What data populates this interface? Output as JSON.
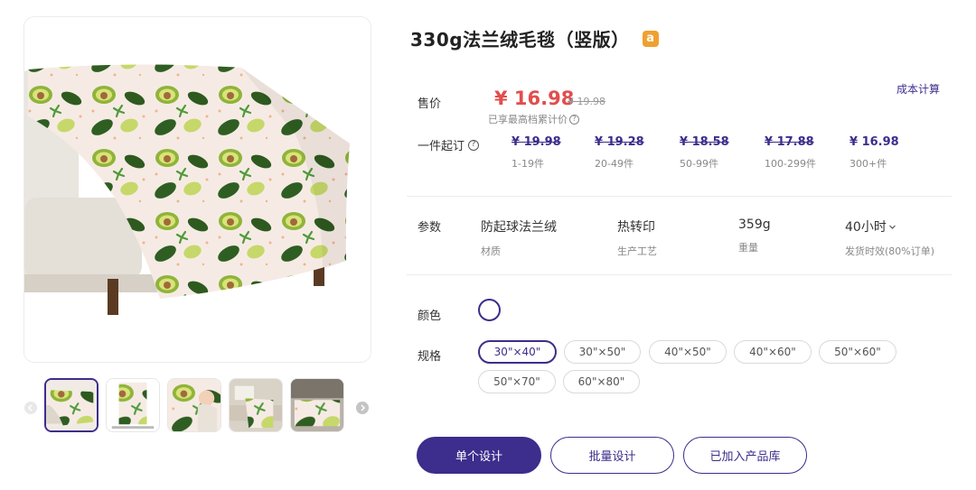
{
  "product": {
    "title": "330g法兰绒毛毯（竖版）",
    "store_badge": "a"
  },
  "pricing": {
    "price_label": "售价",
    "price": "¥ 16.98",
    "original_price": "¥ 19.98",
    "note": "已享最高档累计价",
    "cost_link": "成本计算",
    "moq_label": "一件起订",
    "tiers": [
      {
        "price": "¥ 19.98",
        "range": "1-19件",
        "strike": true
      },
      {
        "price": "¥ 19.28",
        "range": "20-49件",
        "strike": true
      },
      {
        "price": "¥ 18.58",
        "range": "50-99件",
        "strike": true
      },
      {
        "price": "¥ 17.88",
        "range": "100-299件",
        "strike": true
      },
      {
        "price": "¥ 16.98",
        "range": "300+件",
        "strike": false
      }
    ]
  },
  "params": {
    "label": "参数",
    "items": [
      {
        "value": "防起球法兰绒",
        "key": "材质"
      },
      {
        "value": "热转印",
        "key": "生产工艺"
      },
      {
        "value": "359g",
        "key": "重量"
      },
      {
        "value": "40小时",
        "key": "发货时效(80%订单)"
      }
    ]
  },
  "options": {
    "color_label": "颜色",
    "size_label": "规格",
    "selected_color": "#ffffff",
    "sizes": [
      "30\"×40\"",
      "30\"×50\"",
      "40\"×50\"",
      "40\"×60\"",
      "50\"×60\"",
      "50\"×70\"",
      "60\"×80\""
    ],
    "selected_size": "30\"×40\""
  },
  "actions": {
    "single_design": "单个设计",
    "batch_design": "批量设计",
    "added_to_library": "已加入产品库"
  },
  "colors": {
    "brand": "#3d2d8c",
    "price_red": "#e24d4d",
    "badge_orange": "#f0a030"
  }
}
